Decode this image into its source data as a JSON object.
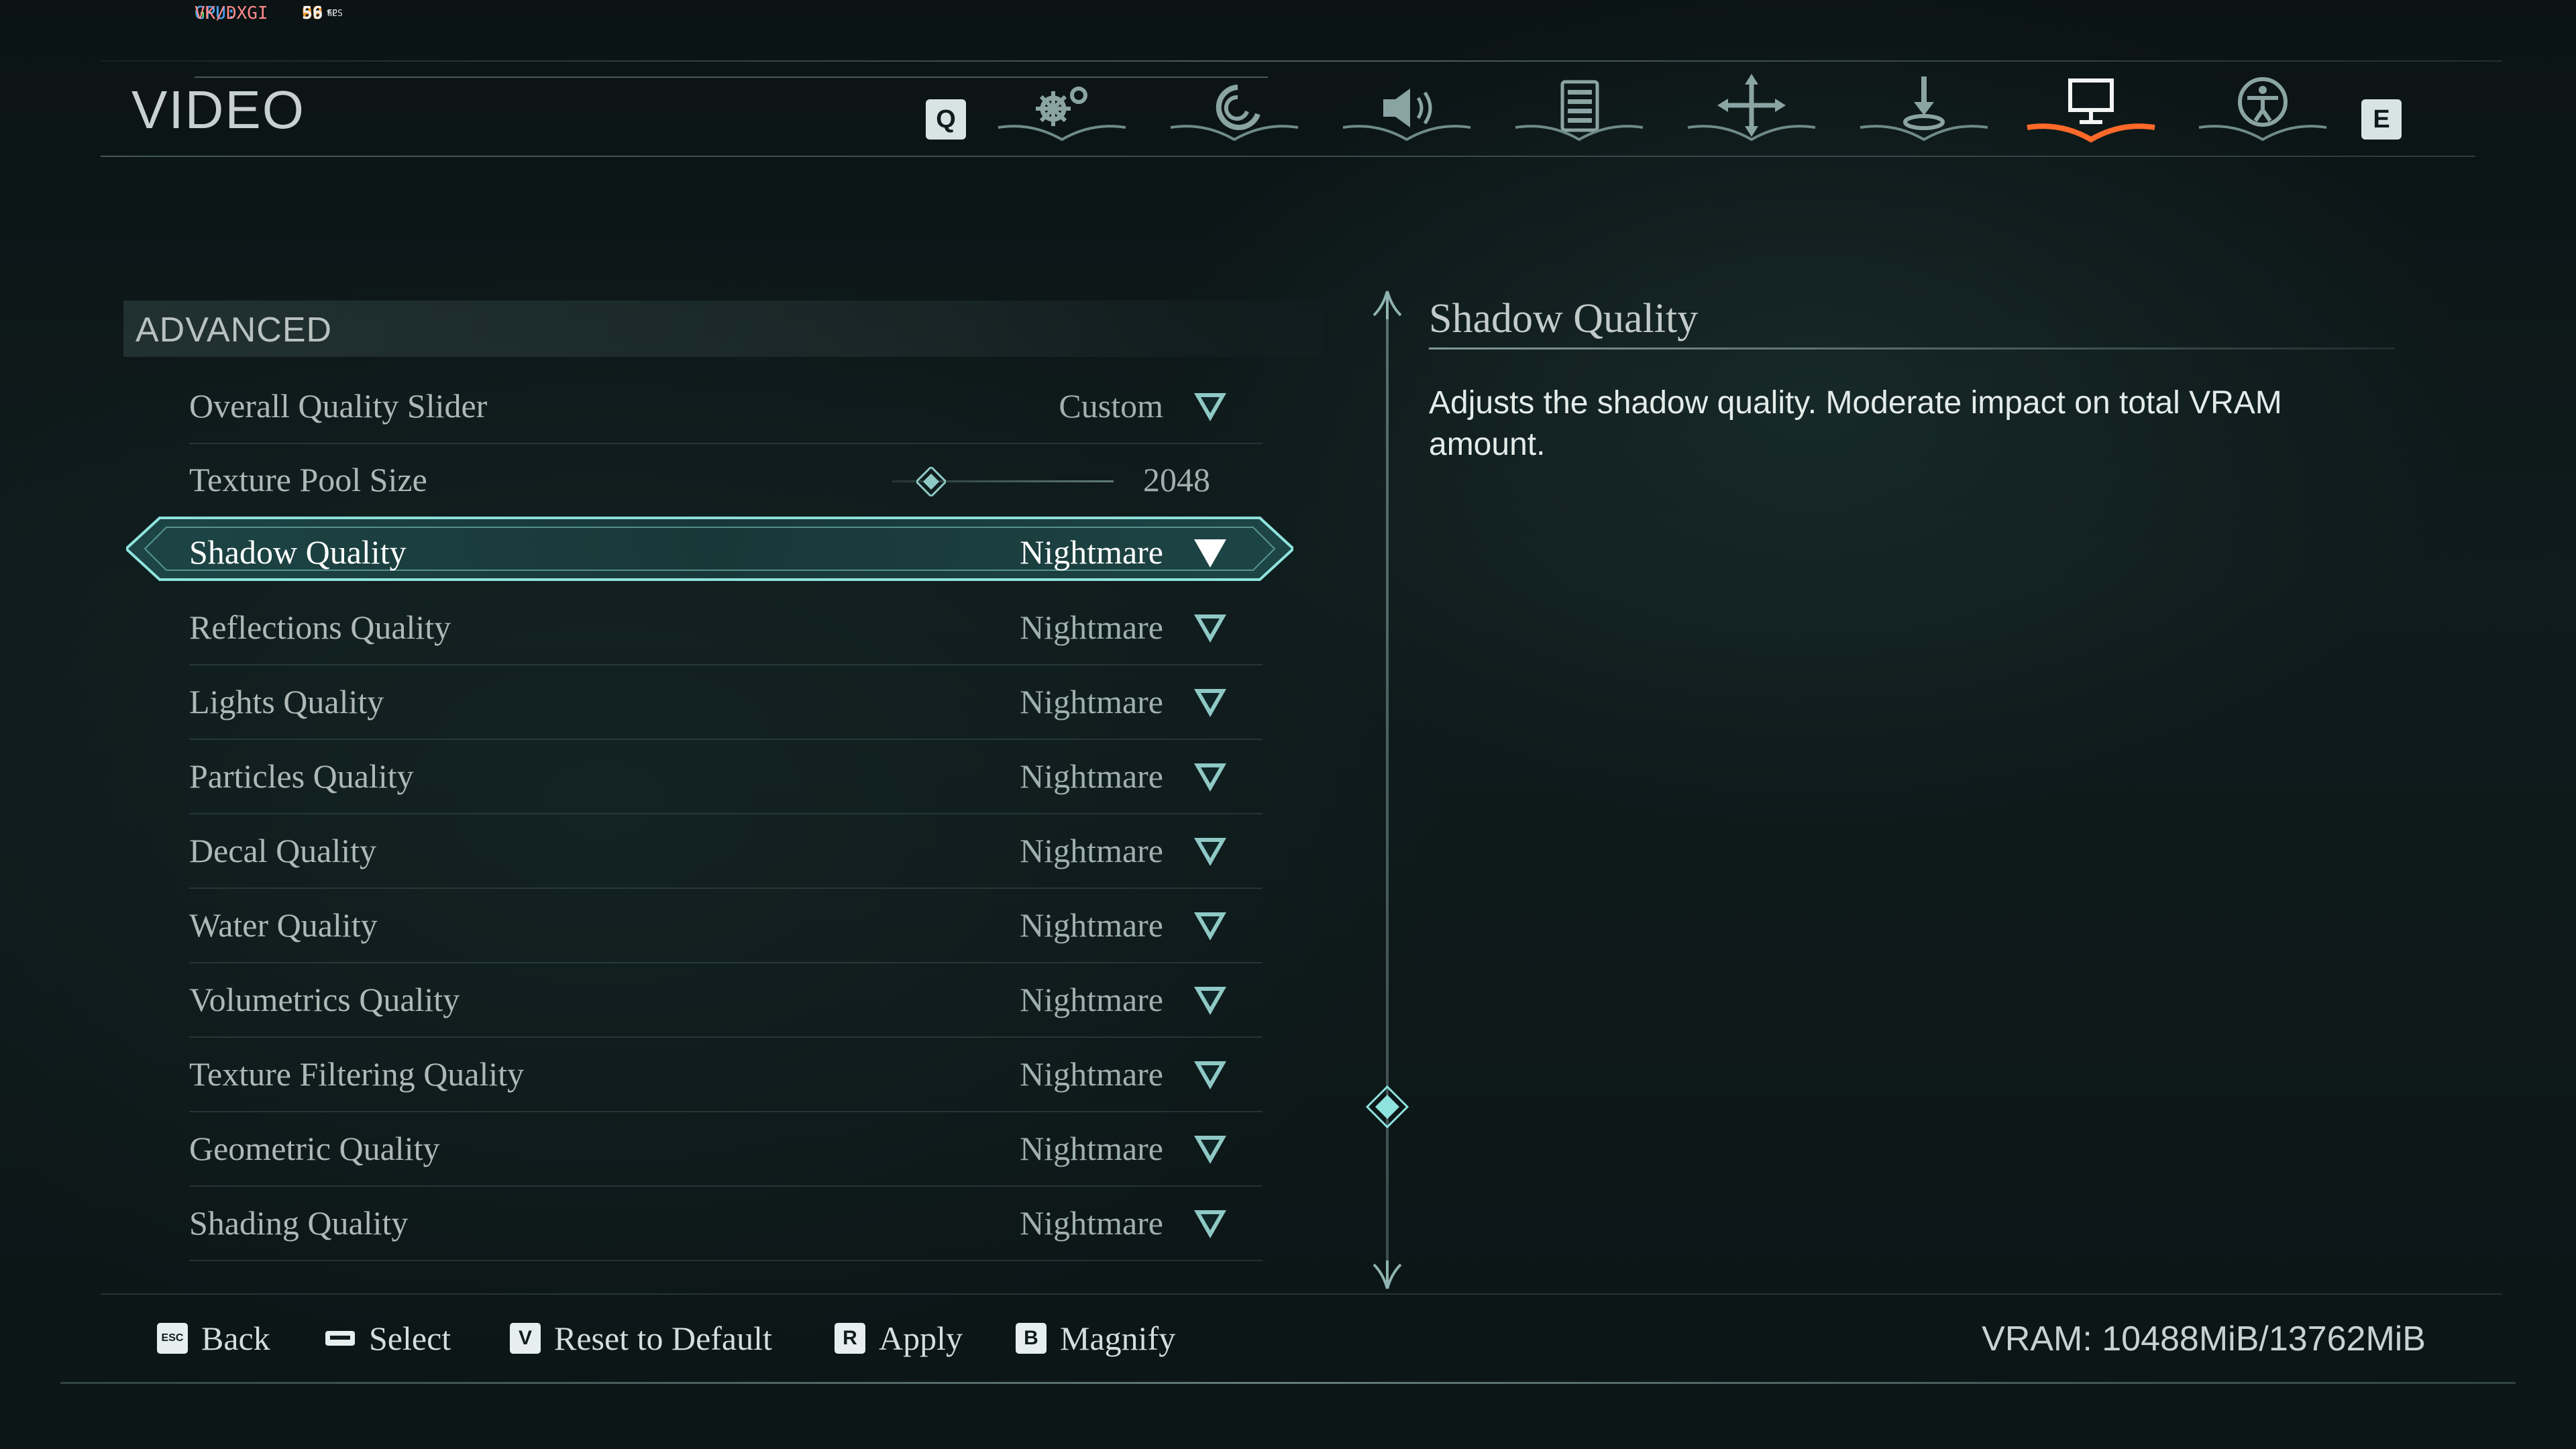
{
  "perf": {
    "rows": [
      {
        "key": "GPU:",
        "value": "99",
        "unit": "%",
        "color": "#5fd25a"
      },
      {
        "key": "CPU:",
        "value": "68",
        "unit": "°C",
        "color": "#4aa3ff"
      },
      {
        "key": "VK/DXGI",
        "value": "56",
        "unit": "FPS",
        "color": "#ff8a8a"
      }
    ],
    "value_color": "#ff9a2e"
  },
  "header": {
    "title": "VIDEO",
    "left_key": "Q",
    "right_key": "E",
    "tabs": [
      {
        "icon": "gear-icon",
        "active": false
      },
      {
        "icon": "swirl-icon",
        "active": false
      },
      {
        "icon": "speaker-icon",
        "active": false
      },
      {
        "icon": "list-icon",
        "active": false
      },
      {
        "icon": "crosshair-arrows-icon",
        "active": false
      },
      {
        "icon": "download-icon",
        "active": false
      },
      {
        "icon": "monitor-icon",
        "active": true
      },
      {
        "icon": "accessibility-icon",
        "active": false
      }
    ],
    "active_color": "#ff6a2a"
  },
  "section": {
    "title": "ADVANCED",
    "rows": [
      {
        "label": "Overall Quality Slider",
        "value": "Custom",
        "type": "dropdown"
      },
      {
        "label": "Texture Pool Size",
        "value": "2048",
        "type": "slider"
      },
      {
        "label": "Shadow Quality",
        "value": "Nightmare",
        "type": "dropdown",
        "selected": true
      },
      {
        "label": "Reflections Quality",
        "value": "Nightmare",
        "type": "dropdown"
      },
      {
        "label": "Lights Quality",
        "value": "Nightmare",
        "type": "dropdown"
      },
      {
        "label": "Particles Quality",
        "value": "Nightmare",
        "type": "dropdown"
      },
      {
        "label": "Decal Quality",
        "value": "Nightmare",
        "type": "dropdown"
      },
      {
        "label": "Water Quality",
        "value": "Nightmare",
        "type": "dropdown"
      },
      {
        "label": "Volumetrics Quality",
        "value": "Nightmare",
        "type": "dropdown"
      },
      {
        "label": "Texture Filtering Quality",
        "value": "Nightmare",
        "type": "dropdown"
      },
      {
        "label": "Geometric Quality",
        "value": "Nightmare",
        "type": "dropdown"
      },
      {
        "label": "Shading Quality",
        "value": "Nightmare",
        "type": "dropdown"
      }
    ]
  },
  "description": {
    "title": "Shadow Quality",
    "text": "Adjusts the shadow quality. Moderate impact on total VRAM amount."
  },
  "footer": {
    "hints": [
      {
        "key": "ESC",
        "label": "Back"
      },
      {
        "key": "",
        "label": "Select"
      },
      {
        "key": "V",
        "label": "Reset to Default"
      },
      {
        "key": "R",
        "label": "Apply"
      },
      {
        "key": "B",
        "label": "Magnify"
      }
    ],
    "vram": "VRAM: 10488MiB/13762MiB"
  },
  "colors": {
    "accent": "#7fd6d2",
    "background": "#0c1617"
  }
}
